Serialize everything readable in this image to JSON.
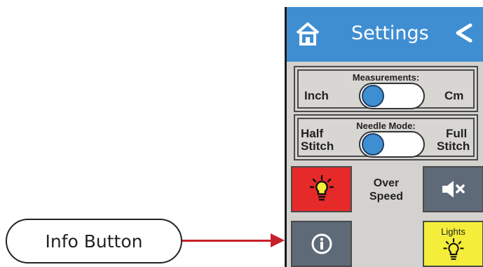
{
  "callout": {
    "label": "Info Button"
  },
  "header": {
    "title": "Settings"
  },
  "measurements": {
    "title": "Measurements:",
    "left": "Inch",
    "right": "Cm"
  },
  "needle": {
    "title": "Needle Mode:",
    "left_1": "Half",
    "left_2": "Stitch",
    "right_1": "Full",
    "right_2": "Stitch"
  },
  "over_speed": {
    "line1": "Over",
    "line2": "Speed"
  },
  "lights": {
    "label": "Lights"
  },
  "colors": {
    "header": "#3f8ed2",
    "light_button": "#e62a2a",
    "gray_button": "#5e6a78",
    "lights_button": "#f4ee3a",
    "arrow": "#c8202a"
  },
  "icons": {
    "home": "home-icon",
    "back": "chevron-left-icon",
    "bulb": "lightbulb-icon",
    "mute": "speaker-mute-icon",
    "info": "info-icon"
  }
}
